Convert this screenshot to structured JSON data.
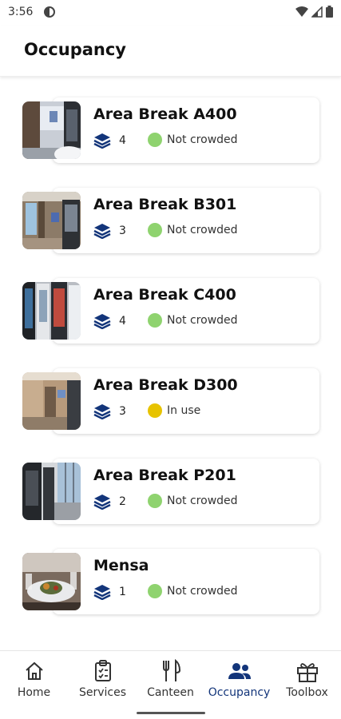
{
  "status_bar": {
    "time": "3:56",
    "icons": [
      "app-notification-icon",
      "wifi-icon",
      "signal-icon",
      "battery-icon"
    ]
  },
  "app_bar": {
    "title": "Occupancy"
  },
  "colors": {
    "accent": "#13357a",
    "not_crowded": "#8fd36f",
    "in_use": "#e7c300"
  },
  "areas": [
    {
      "name": "Area Break A400",
      "floors": "4",
      "status": "Not crowded",
      "status_level": "not_crowded"
    },
    {
      "name": "Area Break B301",
      "floors": "3",
      "status": "Not crowded",
      "status_level": "not_crowded"
    },
    {
      "name": "Area Break C400",
      "floors": "4",
      "status": "Not crowded",
      "status_level": "not_crowded"
    },
    {
      "name": "Area Break D300",
      "floors": "3",
      "status": "In use",
      "status_level": "in_use"
    },
    {
      "name": "Area Break P201",
      "floors": "2",
      "status": "Not crowded",
      "status_level": "not_crowded"
    },
    {
      "name": "Mensa",
      "floors": "1",
      "status": "Not crowded",
      "status_level": "not_crowded"
    }
  ],
  "nav": {
    "items": [
      {
        "label": "Home",
        "icon": "home-icon"
      },
      {
        "label": "Services",
        "icon": "clipboard-icon"
      },
      {
        "label": "Canteen",
        "icon": "cutlery-icon"
      },
      {
        "label": "Occupancy",
        "icon": "people-icon",
        "active": true
      },
      {
        "label": "Toolbox",
        "icon": "gift-box-icon"
      }
    ]
  }
}
